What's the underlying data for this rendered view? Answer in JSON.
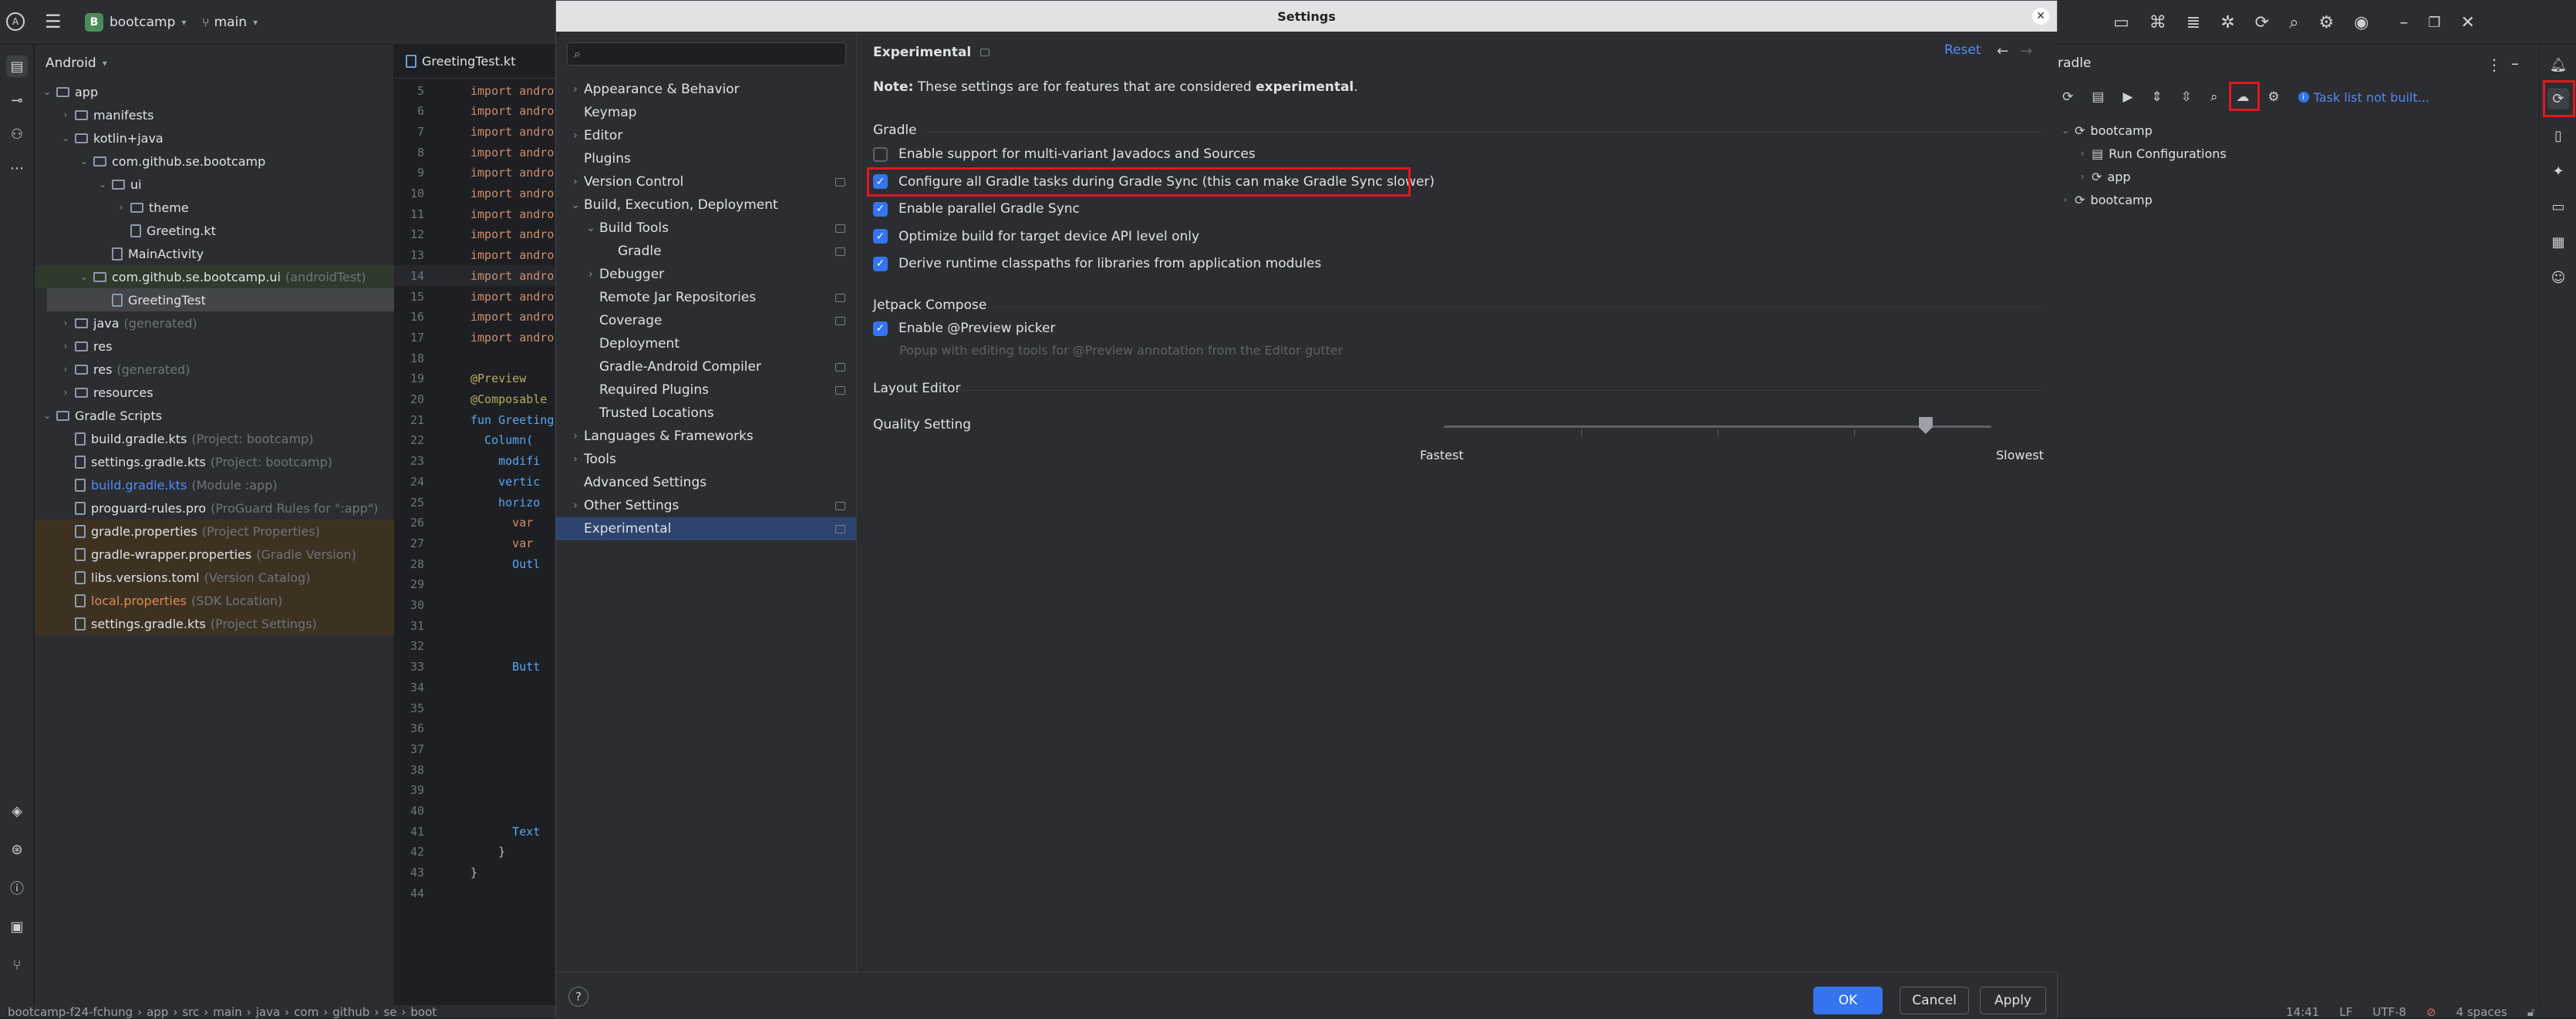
{
  "titlebar": {
    "project_badge": "B",
    "project_name": "bootcamp",
    "branch": "main"
  },
  "project_panel": {
    "view": "Android",
    "tree": [
      {
        "label": "app",
        "dim": "",
        "indent": 0,
        "type": "folder",
        "chev": "v"
      },
      {
        "label": "manifests",
        "dim": "",
        "indent": 1,
        "type": "folder",
        "chev": ">"
      },
      {
        "label": "kotlin+java",
        "dim": "",
        "indent": 1,
        "type": "folder",
        "chev": "v"
      },
      {
        "label": "com.github.se.bootcamp",
        "dim": "",
        "indent": 2,
        "type": "folder",
        "chev": "v"
      },
      {
        "label": "ui",
        "dim": "",
        "indent": 3,
        "type": "folder",
        "chev": "v"
      },
      {
        "label": "theme",
        "dim": "",
        "indent": 4,
        "type": "folder",
        "chev": ">"
      },
      {
        "label": "Greeting.kt",
        "dim": "",
        "indent": 4,
        "type": "file",
        "chev": ""
      },
      {
        "label": "MainActivity",
        "dim": "",
        "indent": 3,
        "type": "file",
        "chev": ""
      },
      {
        "label": "com.github.se.bootcamp.ui",
        "dim": "(androidTest)",
        "indent": 2,
        "type": "folder",
        "chev": "v",
        "highlight": "green"
      },
      {
        "label": "GreetingTest",
        "dim": "",
        "indent": 3,
        "type": "file",
        "chev": "",
        "highlight": "selected"
      },
      {
        "label": "java",
        "dim": "(generated)",
        "indent": 1,
        "type": "folder",
        "chev": ">"
      },
      {
        "label": "res",
        "dim": "",
        "indent": 1,
        "type": "folder",
        "chev": ">"
      },
      {
        "label": "res",
        "dim": "(generated)",
        "indent": 1,
        "type": "folder",
        "chev": ">"
      },
      {
        "label": "resources",
        "dim": "",
        "indent": 1,
        "type": "folder",
        "chev": ">"
      },
      {
        "label": "Gradle Scripts",
        "dim": "",
        "indent": 0,
        "type": "folder",
        "chev": "v"
      },
      {
        "label": "build.gradle.kts",
        "dim": "(Project: bootcamp)",
        "indent": 1,
        "type": "file",
        "chev": ""
      },
      {
        "label": "settings.gradle.kts",
        "dim": "(Project: bootcamp)",
        "indent": 1,
        "type": "file",
        "chev": ""
      },
      {
        "label": "build.gradle.kts",
        "dim": "(Module :app)",
        "indent": 1,
        "type": "file",
        "chev": "",
        "color": "blue"
      },
      {
        "label": "proguard-rules.pro",
        "dim": "(ProGuard Rules for \":app\")",
        "indent": 1,
        "type": "file",
        "chev": ""
      },
      {
        "label": "gradle.properties",
        "dim": "(Project Properties)",
        "indent": 1,
        "type": "file",
        "chev": "",
        "highlight": "orange"
      },
      {
        "label": "gradle-wrapper.properties",
        "dim": "(Gradle Version)",
        "indent": 1,
        "type": "file",
        "chev": "",
        "highlight": "orange"
      },
      {
        "label": "libs.versions.toml",
        "dim": "(Version Catalog)",
        "indent": 1,
        "type": "file",
        "chev": "",
        "highlight": "orange"
      },
      {
        "label": "local.properties",
        "dim": "(SDK Location)",
        "indent": 1,
        "type": "file",
        "chev": "",
        "highlight": "orange",
        "color": "orange"
      },
      {
        "label": "settings.gradle.kts",
        "dim": "(Project Settings)",
        "indent": 1,
        "type": "file",
        "chev": "",
        "highlight": "orange"
      }
    ]
  },
  "editor": {
    "tab": "GreetingTest.kt",
    "lines": [
      {
        "n": "5",
        "code": "import andro",
        "cls": "kw"
      },
      {
        "n": "6",
        "code": "import andro",
        "cls": "kw"
      },
      {
        "n": "7",
        "code": "import andro",
        "cls": "kw"
      },
      {
        "n": "8",
        "code": "import andro",
        "cls": "kw"
      },
      {
        "n": "9",
        "code": "import andro",
        "cls": "kw"
      },
      {
        "n": "10",
        "code": "import andro",
        "cls": "kw"
      },
      {
        "n": "11",
        "code": "import andro",
        "cls": "kw"
      },
      {
        "n": "12",
        "code": "import andro",
        "cls": "kw"
      },
      {
        "n": "13",
        "code": "import andro",
        "cls": "kw"
      },
      {
        "n": "14",
        "code": "import andro",
        "cls": "kw"
      },
      {
        "n": "15",
        "code": "import andro",
        "cls": "kw"
      },
      {
        "n": "16",
        "code": "import andro",
        "cls": "kw"
      },
      {
        "n": "17",
        "code": "import andro",
        "cls": "kw"
      },
      {
        "n": "18",
        "code": "",
        "cls": ""
      },
      {
        "n": "19",
        "code": "@Preview",
        "cls": "ann"
      },
      {
        "n": "20",
        "code": "@Composable",
        "cls": "ann"
      },
      {
        "n": "21",
        "code": "fun Greeting",
        "cls": "fn"
      },
      {
        "n": "22",
        "code": "  Column(",
        "cls": "call"
      },
      {
        "n": "23",
        "code": "    modifi",
        "cls": "param"
      },
      {
        "n": "24",
        "code": "    vertic",
        "cls": "param"
      },
      {
        "n": "25",
        "code": "    horizo",
        "cls": "param"
      },
      {
        "n": "26",
        "code": "      var",
        "cls": "kw"
      },
      {
        "n": "27",
        "code": "      var",
        "cls": "kw"
      },
      {
        "n": "28",
        "code": "      Outl",
        "cls": "call"
      },
      {
        "n": "29",
        "code": "",
        "cls": ""
      },
      {
        "n": "30",
        "code": "",
        "cls": ""
      },
      {
        "n": "31",
        "code": "",
        "cls": ""
      },
      {
        "n": "32",
        "code": "",
        "cls": ""
      },
      {
        "n": "33",
        "code": "      Butt",
        "cls": "call"
      },
      {
        "n": "34",
        "code": "",
        "cls": ""
      },
      {
        "n": "35",
        "code": "",
        "cls": ""
      },
      {
        "n": "36",
        "code": "",
        "cls": ""
      },
      {
        "n": "37",
        "code": "",
        "cls": ""
      },
      {
        "n": "38",
        "code": "",
        "cls": ""
      },
      {
        "n": "39",
        "code": "",
        "cls": ""
      },
      {
        "n": "40",
        "code": "",
        "cls": ""
      },
      {
        "n": "41",
        "code": "      Text",
        "cls": "call"
      },
      {
        "n": "42",
        "code": "    }",
        "cls": ""
      },
      {
        "n": "43",
        "code": "}",
        "cls": ""
      },
      {
        "n": "44",
        "code": "",
        "cls": ""
      }
    ]
  },
  "settings_dialog": {
    "title": "Settings",
    "search_placeholder": "",
    "nav": [
      {
        "label": "Appearance & Behavior",
        "level": 0,
        "chev": ">",
        "bold": true,
        "proj": false
      },
      {
        "label": "Keymap",
        "level": 0,
        "chev": "",
        "bold": true,
        "proj": false
      },
      {
        "label": "Editor",
        "level": 0,
        "chev": ">",
        "bold": true,
        "proj": false
      },
      {
        "label": "Plugins",
        "level": 0,
        "chev": "",
        "bold": true,
        "proj": false
      },
      {
        "label": "Version Control",
        "level": 0,
        "chev": ">",
        "bold": true,
        "proj": true
      },
      {
        "label": "Build, Execution, Deployment",
        "level": 0,
        "chev": "v",
        "bold": true,
        "proj": false
      },
      {
        "label": "Build Tools",
        "level": 1,
        "chev": "v",
        "bold": false,
        "proj": true
      },
      {
        "label": "Gradle",
        "level": 2,
        "chev": "",
        "bold": false,
        "proj": true
      },
      {
        "label": "Debugger",
        "level": 1,
        "chev": ">",
        "bold": false,
        "proj": false
      },
      {
        "label": "Remote Jar Repositories",
        "level": 1,
        "chev": "",
        "bold": false,
        "proj": true
      },
      {
        "label": "Coverage",
        "level": 1,
        "chev": "",
        "bold": false,
        "proj": true
      },
      {
        "label": "Deployment",
        "level": 1,
        "chev": "",
        "bold": false,
        "proj": false
      },
      {
        "label": "Gradle-Android Compiler",
        "level": 1,
        "chev": "",
        "bold": false,
        "proj": true
      },
      {
        "label": "Required Plugins",
        "level": 1,
        "chev": "",
        "bold": false,
        "proj": true
      },
      {
        "label": "Trusted Locations",
        "level": 1,
        "chev": "",
        "bold": false,
        "proj": false
      },
      {
        "label": "Languages & Frameworks",
        "level": 0,
        "chev": ">",
        "bold": true,
        "proj": false
      },
      {
        "label": "Tools",
        "level": 0,
        "chev": ">",
        "bold": true,
        "proj": false
      },
      {
        "label": "Advanced Settings",
        "level": 0,
        "chev": "",
        "bold": true,
        "proj": false
      },
      {
        "label": "Other Settings",
        "level": 0,
        "chev": ">",
        "bold": true,
        "proj": true
      },
      {
        "label": "Experimental",
        "level": 0,
        "chev": "",
        "bold": true,
        "proj": true,
        "selected": true
      }
    ],
    "page": {
      "breadcrumb": "Experimental",
      "reset": "Reset",
      "note_prefix": "Note:",
      "note_text": " These settings are for features that are considered ",
      "note_bold": "experimental",
      "note_end": ".",
      "gradle_header": "Gradle",
      "gradle_options": [
        {
          "label": "Enable support for multi-variant Javadocs and Sources",
          "checked": false
        },
        {
          "label": "Configure all Gradle tasks during Gradle Sync (this can make Gradle Sync slower)",
          "checked": true
        },
        {
          "label": "Enable parallel Gradle Sync",
          "checked": true
        },
        {
          "label": "Optimize build for target device API level only",
          "checked": true
        },
        {
          "label": "Derive runtime classpaths for libraries from application modules",
          "checked": true
        }
      ],
      "compose_header": "Jetpack Compose",
      "compose_option": {
        "label": "Enable @Preview picker",
        "checked": true
      },
      "compose_hint": "Popup with editing tools for @Preview annotation from the Editor gutter",
      "layout_header": "Layout Editor",
      "quality_label": "Quality Setting",
      "slider_min": "Fastest",
      "slider_max": "Slowest",
      "slider_value": 0.88
    },
    "footer": {
      "help": "?",
      "ok": "OK",
      "cancel": "Cancel",
      "apply": "Apply"
    }
  },
  "gradle_panel": {
    "title": "radle",
    "task_list_msg": "Task list not built...",
    "tree": [
      {
        "label": "bootcamp",
        "indent": 0,
        "chev": "v"
      },
      {
        "label": "Run Configurations",
        "indent": 1,
        "chev": ">"
      },
      {
        "label": "app",
        "indent": 1,
        "chev": ">"
      },
      {
        "label": "bootcamp",
        "indent": 0,
        "chev": ">"
      }
    ]
  },
  "statusbar": {
    "breadcrumbs": [
      "bootcamp-f24-fchung",
      "app",
      "src",
      "main",
      "java",
      "com",
      "github",
      "se",
      "boot"
    ],
    "position": "14:41",
    "line_sep": "LF",
    "encoding": "UTF-8",
    "indent": "4 spaces"
  },
  "colors": {
    "accent": "#3574f0",
    "highlight_red": "#e0171f",
    "selected_nav": "#2e436e"
  }
}
